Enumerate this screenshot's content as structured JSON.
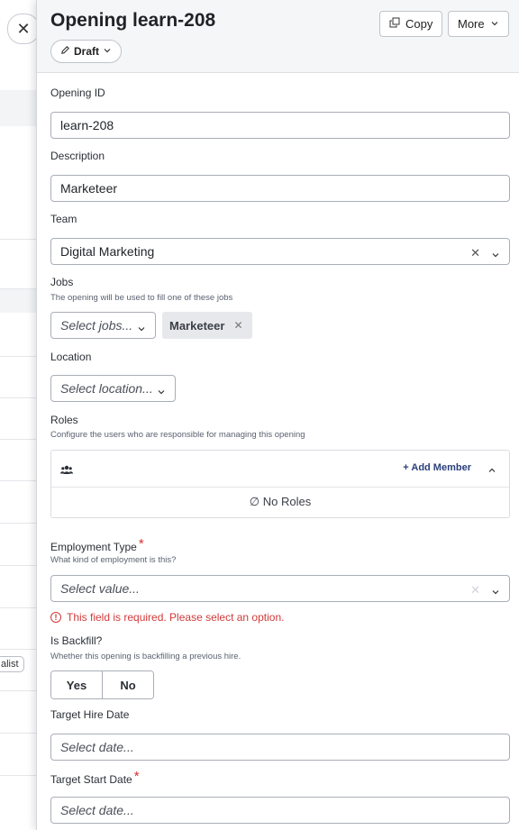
{
  "background": {
    "chip_label": "alist"
  },
  "close_button": {
    "icon": "close-icon",
    "glyph": "✕"
  },
  "header": {
    "title": "Opening learn-208",
    "status_button": "Draft",
    "copy_button": "Copy",
    "more_button": "More"
  },
  "form": {
    "opening_id": {
      "label": "Opening ID",
      "value": "learn-208"
    },
    "description": {
      "label": "Description",
      "value": "Marketeer"
    },
    "team": {
      "label": "Team",
      "value": "Digital Marketing"
    },
    "jobs": {
      "label": "Jobs",
      "help": "The opening will be used to fill one of these jobs",
      "placeholder": "Select jobs...",
      "selected": [
        "Marketeer"
      ]
    },
    "location": {
      "label": "Location",
      "placeholder": "Select location..."
    },
    "roles": {
      "label": "Roles",
      "help": "Configure the users who are responsible for managing this opening",
      "add_member": "+ Add Member",
      "empty": "No Roles"
    },
    "employment_type": {
      "label": "Employment Type",
      "required": "*",
      "help": "What kind of employment is this?",
      "placeholder": "Select value...",
      "error": "This field is required. Please select an option."
    },
    "backfill": {
      "label": "Is Backfill?",
      "help": "Whether this opening is backfilling a previous hire.",
      "options": [
        "Yes",
        "No"
      ]
    },
    "target_hire_date": {
      "label": "Target Hire Date",
      "placeholder": "Select date..."
    },
    "target_start_date": {
      "label": "Target Start Date",
      "required": "*",
      "placeholder": "Select date..."
    }
  },
  "colors": {
    "error": "#d23a3a",
    "link": "#2a3f7a",
    "header_bg": "#f5f6f7"
  }
}
